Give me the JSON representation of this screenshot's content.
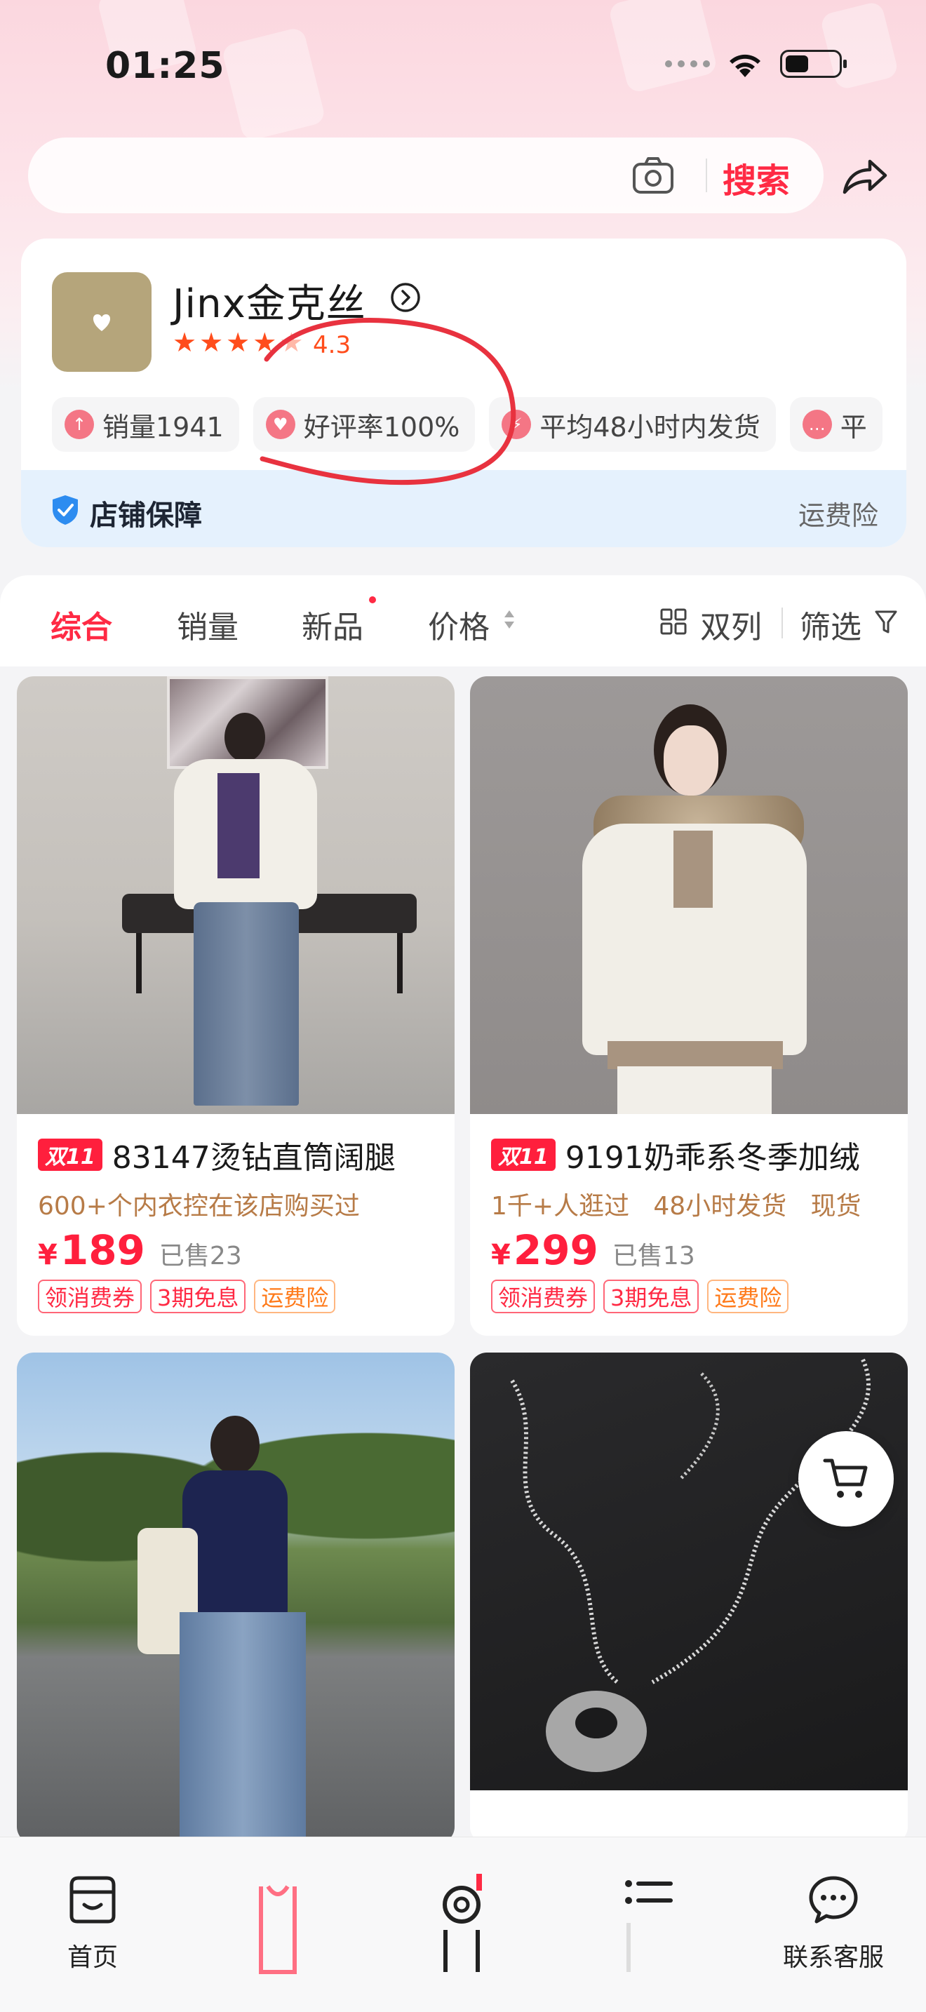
{
  "status_bar": {
    "time": "01:25"
  },
  "search": {
    "action_label": "搜索"
  },
  "store": {
    "name": "Jinx金克丝",
    "rating": "4.3",
    "stars_filled": 4.3,
    "tags": [
      {
        "label": "销量1941",
        "icon": "sales-up-icon",
        "color": "#f36a7a"
      },
      {
        "label": "好评率100%",
        "icon": "heart-badge-icon",
        "color": "#f36a7a"
      },
      {
        "label": "平均48小时内发货",
        "icon": "lightning-icon",
        "color": "#f36a7a"
      },
      {
        "label": "平",
        "icon": "chat-icon",
        "color": "#f36a7a"
      }
    ],
    "guarantee": {
      "title": "店铺保障",
      "right": "运费险"
    }
  },
  "sort_bar": {
    "items": [
      {
        "label": "综合",
        "active": true
      },
      {
        "label": "销量",
        "active": false
      },
      {
        "label": "新品",
        "active": false
      },
      {
        "label": "价格",
        "active": false
      }
    ],
    "layout_label": "双列",
    "filter_label": "筛选"
  },
  "products": [
    {
      "badge": "双11",
      "title": "83147烫钻直筒阔腿",
      "subtitle": "600+个内衣控在该店购买过",
      "currency": "¥",
      "price": "189",
      "sold": "已售23",
      "coupons": [
        "领消费券",
        "3期免息",
        "运费险"
      ]
    },
    {
      "badge": "双11",
      "title": "9191奶乖系冬季加绒",
      "subtitle": "1千+人逛过   48小时发货   现货",
      "currency": "¥",
      "price": "299",
      "sold": "已售13",
      "coupons": [
        "领消费券",
        "3期免息",
        "运费险"
      ]
    }
  ],
  "tab_bar": {
    "items": [
      {
        "label": "首页",
        "icon": "store-home-icon"
      },
      {
        "label": "",
        "icon": "bag-icon"
      },
      {
        "label": "",
        "icon": "camera-live-icon"
      },
      {
        "label": "",
        "icon": "category-list-icon"
      },
      {
        "label": "联系客服",
        "icon": "customer-service-icon"
      }
    ]
  },
  "colors": {
    "accent": "#ff2a44",
    "price": "#ff1f3d",
    "star": "#ff4d1c",
    "store_logo": "#b5a57b",
    "guarantee_bg": "#e5f1fd"
  }
}
